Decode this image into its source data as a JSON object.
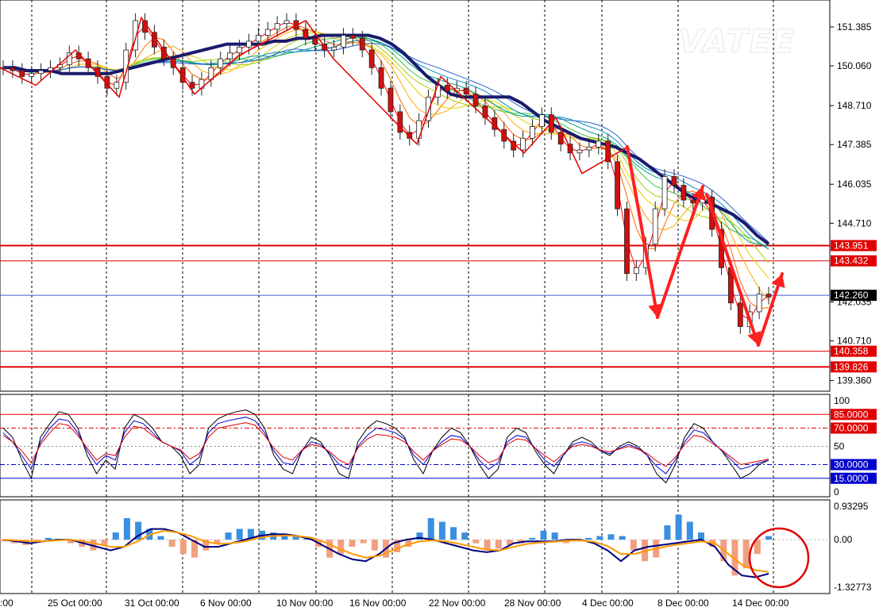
{
  "watermark": "VATEE",
  "chart_data": [
    {
      "type": "candlestick",
      "title": "",
      "y_ticks": [
        "151.385",
        "150.060",
        "148.710",
        "147.385",
        "146.035",
        "144.710",
        "142.035",
        "140.710",
        "139.360"
      ],
      "x_ticks": [
        ":00",
        "25 Oct 00:00",
        "31 Oct 00:00",
        "6 Nov 00:00",
        "10 Nov 00:00",
        "16 Nov 00:00",
        "22 Nov 00:00",
        "28 Nov 00:00",
        "4 Dec 00:00",
        "8 Dec 00:00",
        "14 Dec 00:00"
      ],
      "current_price": {
        "label": "142.260",
        "value": 142.26
      },
      "levels": [
        {
          "label": "143.951",
          "value": 143.951,
          "color": "#e00000"
        },
        {
          "label": "143.432",
          "value": 143.432,
          "color": "#e00000"
        },
        {
          "label": "140.358",
          "value": 140.358,
          "color": "#e00000"
        },
        {
          "label": "139.826",
          "value": 139.826,
          "color": "#e00000"
        }
      ],
      "ylim": [
        139.0,
        152.3
      ],
      "close_path": [
        150.0,
        149.9,
        149.7,
        149.8,
        149.9,
        150.0,
        150.1,
        150.5,
        150.3,
        150.0,
        149.7,
        149.3,
        149.5,
        150.6,
        151.6,
        151.2,
        150.7,
        150.3,
        150.0,
        149.5,
        149.3,
        149.6,
        150.0,
        150.3,
        150.5,
        150.7,
        150.9,
        151.1,
        151.3,
        151.5,
        151.6,
        151.3,
        151.0,
        150.8,
        150.6,
        150.7,
        151.1,
        151.0,
        150.6,
        150.0,
        149.3,
        148.5,
        147.8,
        147.6,
        148.2,
        149.0,
        149.4,
        149.2,
        149.3,
        149.1,
        148.7,
        148.3,
        147.9,
        147.5,
        147.2,
        147.6,
        148.0,
        148.4,
        147.8,
        147.4,
        147.1,
        147.2,
        147.3,
        147.5,
        146.8,
        145.2,
        143.0,
        143.2,
        144.0,
        145.2,
        146.3,
        146.0,
        145.5,
        145.4,
        145.6,
        144.5,
        143.2,
        142.0,
        141.2,
        141.7,
        142.3,
        142.2
      ],
      "ma_thick": [
        150.0,
        150.0,
        149.9,
        149.9,
        149.9,
        149.8,
        149.8,
        149.8,
        149.8,
        149.8,
        149.9,
        150.0,
        150.1,
        150.2,
        150.3,
        150.4,
        150.5,
        150.6,
        150.7,
        150.8,
        150.8,
        150.8,
        150.8,
        150.9,
        150.9,
        151.0,
        151.0,
        151.1,
        151.1,
        151.1,
        151.1,
        151.1,
        151.0,
        150.8,
        150.5,
        150.1,
        149.7,
        149.4,
        149.1,
        149.0,
        149.0,
        149.0,
        149.0,
        149.0,
        148.8,
        148.5,
        148.2,
        148.0,
        147.8,
        147.6,
        147.5,
        147.4,
        147.3,
        147.1,
        146.9,
        146.6,
        146.3,
        146.0,
        145.7,
        145.5,
        145.4,
        145.2,
        145.0,
        144.7,
        144.3,
        144.0
      ],
      "annotations": [
        {
          "type": "arrow",
          "from": [
            146.95,
            147.31
          ],
          "to": [
            146.6,
            141.1
          ]
        },
        {
          "type": "arrow",
          "from": [
            146.6,
            141.1
          ],
          "to": [
            146.58,
            146.13
          ]
        },
        {
          "type": "arrow",
          "from": [
            146.6,
            146.13
          ],
          "to": [
            141.1,
            140.3
          ]
        },
        {
          "type": "arrow",
          "from": [
            141.1,
            140.3
          ],
          "to": [
            142.7,
            142.8
          ]
        }
      ]
    },
    {
      "type": "line",
      "title": "",
      "y_ticks": [
        "100",
        "50",
        "0"
      ],
      "levels": [
        {
          "label": "85.0000",
          "value": 85,
          "color": "#e00000"
        },
        {
          "label": "70.0000",
          "value": 70,
          "color": "#e00000"
        },
        {
          "label": "30.0000",
          "value": 30,
          "color": "#0000cc"
        },
        {
          "label": "15.0000",
          "value": 15,
          "color": "#0000cc"
        }
      ],
      "ylim": [
        0,
        100
      ],
      "series": [
        {
          "color": "#000000",
          "values": [
            70,
            60,
            35,
            15,
            60,
            75,
            88,
            85,
            70,
            40,
            20,
            35,
            25,
            70,
            85,
            80,
            70,
            55,
            50,
            40,
            20,
            30,
            70,
            80,
            85,
            88,
            90,
            85,
            70,
            40,
            25,
            20,
            45,
            60,
            55,
            40,
            20,
            15,
            55,
            70,
            78,
            75,
            70,
            60,
            35,
            20,
            45,
            60,
            70,
            65,
            50,
            30,
            15,
            25,
            60,
            70,
            65,
            45,
            30,
            20,
            40,
            55,
            60,
            55,
            45,
            40,
            50,
            55,
            50,
            40,
            20,
            10,
            30,
            60,
            75,
            70,
            55,
            45,
            30,
            15,
            20,
            30,
            35
          ]
        },
        {
          "color": "#0000cc",
          "values": [
            65,
            55,
            40,
            25,
            55,
            70,
            80,
            78,
            65,
            45,
            30,
            40,
            35,
            65,
            78,
            75,
            65,
            55,
            50,
            45,
            30,
            38,
            65,
            75,
            78,
            80,
            82,
            78,
            65,
            45,
            32,
            30,
            45,
            55,
            52,
            42,
            30,
            25,
            50,
            62,
            70,
            68,
            65,
            58,
            40,
            30,
            45,
            55,
            62,
            60,
            50,
            35,
            25,
            32,
            55,
            62,
            60,
            48,
            35,
            28,
            40,
            52,
            55,
            52,
            45,
            42,
            48,
            52,
            48,
            40,
            28,
            20,
            35,
            55,
            68,
            65,
            55,
            45,
            35,
            25,
            28,
            32,
            35
          ]
        },
        {
          "color": "#e00000",
          "values": [
            62,
            55,
            45,
            32,
            52,
            65,
            75,
            73,
            62,
            48,
            35,
            42,
            40,
            60,
            72,
            70,
            62,
            55,
            50,
            46,
            36,
            42,
            60,
            70,
            72,
            74,
            76,
            73,
            62,
            48,
            38,
            35,
            46,
            52,
            50,
            44,
            35,
            30,
            48,
            58,
            63,
            62,
            60,
            55,
            44,
            35,
            45,
            52,
            58,
            57,
            50,
            40,
            32,
            36,
            52,
            58,
            57,
            48,
            40,
            33,
            42,
            50,
            52,
            50,
            46,
            44,
            47,
            50,
            47,
            42,
            34,
            28,
            38,
            52,
            62,
            60,
            53,
            46,
            38,
            30,
            32,
            34,
            36
          ]
        }
      ]
    },
    {
      "type": "bar",
      "title": "",
      "y_ticks": [
        "0.93295",
        "0.00",
        "-1.32773"
      ],
      "ylim": [
        -1.32773,
        0.93295
      ],
      "values": [
        -0.05,
        -0.1,
        -0.15,
        -0.05,
        0.05,
        0.02,
        -0.1,
        -0.2,
        -0.3,
        -0.15,
        0.2,
        0.6,
        0.5,
        0.3,
        0.1,
        -0.2,
        -0.4,
        -0.5,
        -0.3,
        -0.1,
        0.2,
        0.3,
        0.3,
        0.25,
        0.2,
        0.15,
        0.1,
        0.05,
        -0.2,
        -0.5,
        -0.4,
        -0.2,
        -0.1,
        -0.3,
        -0.5,
        -0.35,
        -0.2,
        0.2,
        0.6,
        0.5,
        0.35,
        0.2,
        -0.1,
        -0.3,
        -0.25,
        -0.15,
        -0.1,
        0.05,
        0.25,
        0.2,
        -0.1,
        -0.05,
        0.05,
        0.1,
        0.15,
        0.1,
        -0.3,
        -0.6,
        -0.5,
        0.4,
        0.7,
        0.5,
        0.2,
        -0.2,
        -0.6,
        -1.0,
        -0.8,
        -0.4,
        0.1
      ],
      "series": [
        {
          "name": "",
          "color": "#000080",
          "values": [
            0.0,
            -0.05,
            -0.1,
            -0.05,
            0.0,
            0.0,
            -0.1,
            -0.2,
            -0.3,
            -0.2,
            0.1,
            0.3,
            0.3,
            0.2,
            0.0,
            -0.2,
            -0.2,
            -0.1,
            0.0,
            0.1,
            0.15,
            0.15,
            0.1,
            0.0,
            -0.2,
            -0.4,
            -0.55,
            -0.6,
            -0.4,
            -0.1,
            0.0,
            0.05,
            0.0,
            -0.1,
            -0.2,
            -0.3,
            -0.35,
            -0.3,
            -0.1,
            -0.05,
            -0.05,
            -0.05,
            0.0,
            0.0,
            -0.1,
            -0.3,
            -0.6,
            -0.3,
            -0.2,
            -0.15,
            -0.1,
            -0.05,
            0.0,
            -0.2,
            -0.7,
            -1.0,
            -1.05,
            -0.95
          ]
        },
        {
          "name": "",
          "color": "#ff9900",
          "values": [
            0.0,
            -0.02,
            -0.05,
            -0.05,
            -0.02,
            0.0,
            -0.05,
            -0.12,
            -0.2,
            -0.2,
            -0.05,
            0.15,
            0.25,
            0.2,
            0.1,
            -0.05,
            -0.12,
            -0.1,
            -0.05,
            0.05,
            0.1,
            0.12,
            0.1,
            0.05,
            -0.08,
            -0.25,
            -0.4,
            -0.5,
            -0.45,
            -0.3,
            -0.15,
            -0.05,
            -0.02,
            -0.05,
            -0.12,
            -0.2,
            -0.28,
            -0.3,
            -0.2,
            -0.12,
            -0.08,
            -0.06,
            -0.03,
            -0.02,
            -0.06,
            -0.18,
            -0.4,
            -0.4,
            -0.3,
            -0.22,
            -0.15,
            -0.1,
            -0.05,
            -0.1,
            -0.4,
            -0.7,
            -0.85,
            -0.9
          ]
        }
      ]
    }
  ]
}
